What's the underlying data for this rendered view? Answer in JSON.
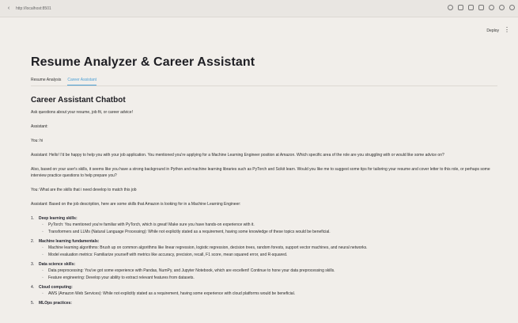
{
  "browser": {
    "url": "http://localhost:8501"
  },
  "header": {
    "deploy_label": "Deploy",
    "menu_glyph": "⋮"
  },
  "page": {
    "title": "Resume Analyzer & Career Assistant",
    "tabs": [
      {
        "label": "Resume Analysis",
        "active": false
      },
      {
        "label": "Career Assistant",
        "active": true
      }
    ],
    "section_title": "Career Assistant Chatbot",
    "prompt_text": "Ask questions about your resume, job fit, or career advice!"
  },
  "chat": {
    "messages": [
      "Assistant:",
      "You: hi",
      "Assistant: Hello! I'd be happy to help you with your job application. You mentioned you're applying for a Machine Learning Engineer position at Amazon. Which specific area of the role are you struggling with or would like some advice on?",
      "Also, based on your user's skills, it seems like you have a strong background in Python and machine learning libraries such as PyTorch and Scikit learn. Would you like me to suggest some tips for tailoring your resume and cover letter to this role, or perhaps some interview practice questions to help prepare you?",
      "You: What are the skills that i need develop to match this job",
      "Assistant: Based on the job description, here are some skills that Amazon is looking for in a Machine Learning Engineer:"
    ],
    "skills": [
      {
        "num": "1.",
        "title": "Deep learning skills:",
        "items": [
          "PyTorch: You mentioned you're familiar with PyTorch, which is great! Make sure you have hands-on experience with it.",
          "Transformers and LLMs (Natural Language Processing): While not explicitly stated as a requirement, having some knowledge of these topics would be beneficial."
        ]
      },
      {
        "num": "2.",
        "title": "Machine learning fundamentals:",
        "items": [
          "Machine learning algorithms: Brush up on common algorithms like linear regression, logistic regression, decision trees, random forests, support vector machines, and neural networks.",
          "Model evaluation metrics: Familiarize yourself with metrics like accuracy, precision, recall, F1 score, mean squared error, and R-squared."
        ]
      },
      {
        "num": "3.",
        "title": "Data science skills:",
        "items": [
          "Data preprocessing: You've got some experience with Pandas, NumPy, and Jupyter Notebook, which are excellent! Continue to hone your data preprocessing skills.",
          "Feature engineering: Develop your ability to extract relevant features from datasets."
        ]
      },
      {
        "num": "4.",
        "title": "Cloud computing:",
        "items": [
          "AWS (Amazon Web Services): While not explicitly stated as a requirement, having some experience with cloud platforms would be beneficial."
        ]
      },
      {
        "num": "5.",
        "title": "MLOps practices:",
        "items": []
      }
    ]
  }
}
